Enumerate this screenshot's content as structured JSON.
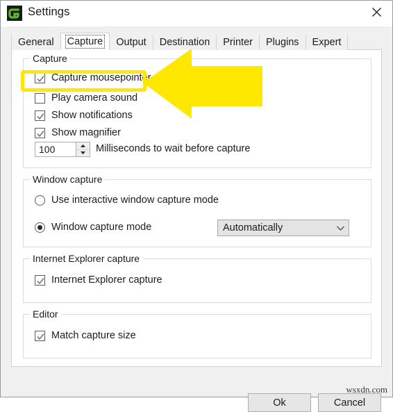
{
  "window": {
    "title": "Settings",
    "icon": "greenshot-logo-icon",
    "close_icon": "close-icon"
  },
  "tabs": [
    {
      "label": "General",
      "selected": false
    },
    {
      "label": "Capture",
      "selected": true
    },
    {
      "label": "Output",
      "selected": false
    },
    {
      "label": "Destination",
      "selected": false
    },
    {
      "label": "Printer",
      "selected": false
    },
    {
      "label": "Plugins",
      "selected": false
    },
    {
      "label": "Expert",
      "selected": false
    }
  ],
  "groups": {
    "capture": {
      "title": "Capture",
      "checkboxes": [
        {
          "label": "Capture mousepointer",
          "checked": true
        },
        {
          "label": "Play camera sound",
          "checked": false
        },
        {
          "label": "Show notifications",
          "checked": true
        },
        {
          "label": "Show magnifier",
          "checked": true
        }
      ],
      "spinner": {
        "value": "100",
        "caption": "Milliseconds to wait before capture",
        "up_icon": "spinner-up-arrow-icon",
        "down_icon": "spinner-down-arrow-icon"
      }
    },
    "window_capture": {
      "title": "Window capture",
      "radios": [
        {
          "label": "Use interactive window capture mode",
          "checked": false
        },
        {
          "label": "Window capture mode",
          "checked": true
        }
      ],
      "combo": {
        "value": "Automatically",
        "arrow_icon": "chevron-down-icon"
      }
    },
    "ie_capture": {
      "title": "Internet Explorer capture",
      "checkboxes": [
        {
          "label": "Internet Explorer capture",
          "checked": true
        }
      ]
    },
    "editor": {
      "title": "Editor",
      "checkboxes": [
        {
          "label": "Match capture size",
          "checked": true
        }
      ]
    }
  },
  "footer": {
    "ok_label": "Ok",
    "cancel_label": "Cancel"
  },
  "watermark": "wsxdn.com",
  "annotation": {
    "highlight_target": "Capture mousepointer",
    "highlight_color": "#ffe800",
    "arrow_color": "#ffe800",
    "arrow_direction": "left"
  }
}
